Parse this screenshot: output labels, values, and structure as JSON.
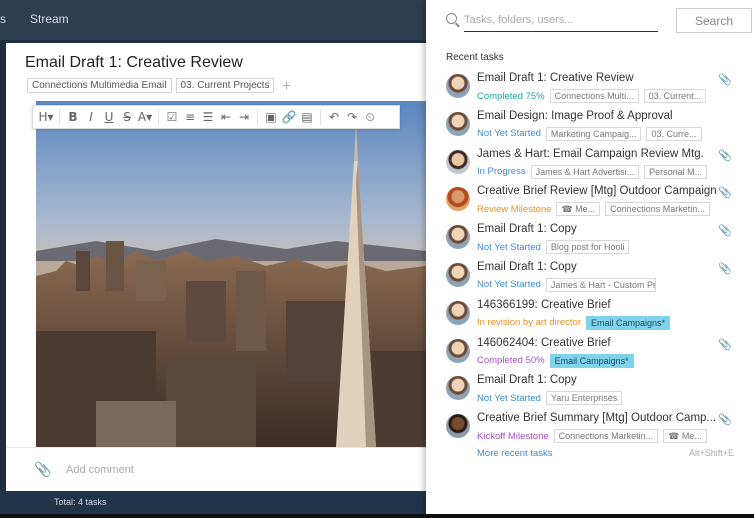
{
  "nav": {
    "left_fragment": "s",
    "stream": "Stream"
  },
  "task": {
    "title": "Email Draft 1: Creative Review",
    "tags": [
      "Connections Multimedia Email",
      "03. Current Projects"
    ],
    "add_tag": "+",
    "toolbar": [
      "H▾",
      "B",
      "I",
      "U",
      "S",
      "A▾",
      "☑",
      "≡",
      "☰",
      "⇤",
      "⇥",
      "▣",
      "🔗",
      "▤",
      "↶",
      "↷",
      "⏲"
    ],
    "comment_placeholder": "Add comment",
    "footer": "Total: 4 tasks"
  },
  "search": {
    "placeholder": "Tasks, folders, users...",
    "button": "Search",
    "recent_label": "Recent tasks",
    "more": "More recent tasks",
    "shortcut": "Alt+Shift+E"
  },
  "recent_tasks": [
    {
      "title": "Email Draft 1: Creative Review",
      "status": "Completed 75%",
      "status_color": "#1ba89b",
      "tags": [
        "Connections Multi...",
        "03. Current..."
      ],
      "clip": true,
      "avatar": "a1"
    },
    {
      "title": "Email Design: Image Proof & Approval",
      "status": "Not Yet Started",
      "status_color": "#3d8bd6",
      "tags": [
        "Marketing Campaig...",
        "03. Curre..."
      ],
      "clip": false,
      "avatar": "a1"
    },
    {
      "title": "James & Hart: Email Campaign Review Mtg.",
      "status": "In Progress",
      "status_color": "#3d8bd6",
      "tags": [
        "James & Hart Advertisi...",
        "Personal M..."
      ],
      "clip": true,
      "avatar": "a2"
    },
    {
      "title": "Creative Brief Review [Mtg] Outdoor Campaign",
      "status": "Review Milestone",
      "status_color": "#e8912a",
      "tags": [
        "☎ Me...",
        "Connections Marketin..."
      ],
      "clip": true,
      "avatar": "a3"
    },
    {
      "title": "Email Draft 1: Copy",
      "status": "Not Yet Started",
      "status_color": "#3d8bd6",
      "tags": [
        "Blog post for Hooli"
      ],
      "clip": true,
      "avatar": "a1"
    },
    {
      "title": "Email Draft 1: Copy",
      "status": "Not Yet Started",
      "status_color": "#3d8bd6",
      "tags": [
        "James & Hart - Custom Project"
      ],
      "clip": true,
      "avatar": "a1"
    },
    {
      "title": "146366199: Creative Brief",
      "status": "In revision by art director",
      "status_color": "#e8912a",
      "tags": [
        "Email Campaigns*"
      ],
      "highlight": true,
      "clip": false,
      "avatar": "a1"
    },
    {
      "title": "146062404: Creative Brief",
      "status": "Completed 50%",
      "status_color": "#a450c8",
      "tags": [
        "Email Campaigns*"
      ],
      "highlight": true,
      "clip": true,
      "avatar": "a1"
    },
    {
      "title": "Email Draft 1: Copy",
      "status": "Not Yet Started",
      "status_color": "#3d8bd6",
      "tags": [
        "Yaru Enterprises"
      ],
      "clip": false,
      "avatar": "a1"
    },
    {
      "title": "Creative Brief Summary [Mtg] Outdoor Camp...",
      "status": "Kickoff Milestone",
      "status_color": "#a450c8",
      "tags": [
        "Connections Marketin...",
        "☎ Me..."
      ],
      "clip": true,
      "avatar": "a4"
    }
  ]
}
